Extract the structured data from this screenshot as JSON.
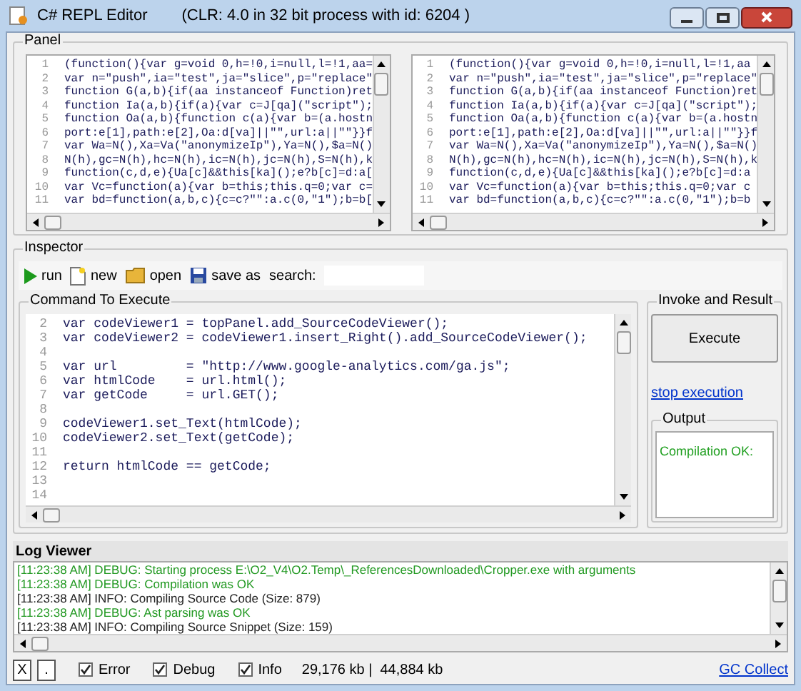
{
  "window": {
    "title": "C# REPL Editor",
    "subtitle": "(CLR: 4.0 in 32 bit process with id: 6204 )"
  },
  "panel": {
    "title": "Panel",
    "viewers": [
      {
        "lines": [
          {
            "number": "1",
            "text": "(function(){var g=void 0,h=!0,i=null,l=!1,aa="
          },
          {
            "number": "2",
            "text": "var n=\"push\",ia=\"test\",ja=\"slice\",p=\"replace\""
          },
          {
            "number": "3",
            "text": "function G(a,b){if(aa instanceof Function)ret"
          },
          {
            "number": "4",
            "text": "function Ia(a,b){if(a){var c=J[qa](\"script\");"
          },
          {
            "number": "5",
            "text": "function Oa(a,b){function c(a){var b=(a.hostn"
          },
          {
            "number": "6",
            "text": "port:e[1],path:e[2],Oa:d[va]||\"\",url:a||\"\"}}f"
          },
          {
            "number": "7",
            "text": "var Wa=N(),Xa=Va(\"anonymizeIp\"),Ya=N(),$a=N()"
          },
          {
            "number": "8",
            "text": "N(h),gc=N(h),hc=N(h),ic=N(h),jc=N(h),S=N(h),k"
          },
          {
            "number": "9",
            "text": "function(c,d,e){Ua[c]&&this[ka]();e?b[c]=d:a["
          },
          {
            "number": "10",
            "text": "var Vc=function(a){var b=this;this.q=0;var c="
          },
          {
            "number": "11",
            "text": "var bd=function(a,b,c){c=c?\"\":a.c(0,\"1\");b=b["
          }
        ]
      },
      {
        "lines": [
          {
            "number": "1",
            "text": "(function(){var g=void 0,h=!0,i=null,l=!1,aa"
          },
          {
            "number": "2",
            "text": "var n=\"push\",ia=\"test\",ja=\"slice\",p=\"replace\""
          },
          {
            "number": "3",
            "text": "function G(a,b){if(aa instanceof Function)ret"
          },
          {
            "number": "4",
            "text": "function Ia(a,b){if(a){var c=J[qa](\"script\");"
          },
          {
            "number": "5",
            "text": "function Oa(a,b){function c(a){var b=(a.hostn"
          },
          {
            "number": "6",
            "text": "port:e[1],path:e[2],Oa:d[va]||\"\",url:a||\"\"}}f"
          },
          {
            "number": "7",
            "text": "var Wa=N(),Xa=Va(\"anonymizeIp\"),Ya=N(),$a=N()"
          },
          {
            "number": "8",
            "text": "N(h),gc=N(h),hc=N(h),ic=N(h),jc=N(h),S=N(h),k"
          },
          {
            "number": "9",
            "text": "function(c,d,e){Ua[c]&&this[ka]();e?b[c]=d:a"
          },
          {
            "number": "10",
            "text": "var Vc=function(a){var b=this;this.q=0;var c"
          },
          {
            "number": "11",
            "text": "var bd=function(a,b,c){c=c?\"\":a.c(0,\"1\");b=b"
          }
        ]
      }
    ]
  },
  "inspector": {
    "title": "Inspector",
    "toolbar": [
      {
        "kind": "run",
        "label": "run"
      },
      {
        "kind": "new",
        "label": "new"
      },
      {
        "kind": "open",
        "label": "open"
      },
      {
        "kind": "save",
        "label": "save as"
      }
    ],
    "search_label": "search:"
  },
  "command": {
    "title": "Command To Execute",
    "lines": [
      {
        "number": "2",
        "text": "var codeViewer1 = topPanel.add_SourceCodeViewer();"
      },
      {
        "number": "3",
        "text": "var codeViewer2 = codeViewer1.insert_Right().add_SourceCodeViewer();"
      },
      {
        "number": "4"
      },
      {
        "number": "5",
        "text": "var url         = \"http://www.google-analytics.com/ga.js\";"
      },
      {
        "number": "6",
        "text": "var htmlCode    = url.html();"
      },
      {
        "number": "7",
        "text": "var getCode     = url.GET();"
      },
      {
        "number": "8"
      },
      {
        "number": "9",
        "text": "codeViewer1.set_Text(htmlCode);"
      },
      {
        "number": "10",
        "text": "codeViewer2.set_Text(getCode);"
      },
      {
        "number": "11"
      },
      {
        "number": "12",
        "text": "return htmlCode == getCode;"
      },
      {
        "number": "13"
      },
      {
        "number": "14"
      }
    ]
  },
  "invoke": {
    "title": "Invoke and Result",
    "execute": "Execute",
    "stop": "stop execution",
    "output_title": "Output",
    "output": "Compilation OK:"
  },
  "log": {
    "title": "Log Viewer",
    "entries": [
      {
        "kind": "debug",
        "text": "[11:23:38 AM] DEBUG: Starting process E:\\O2_V4\\O2.Temp\\_ReferencesDownloaded\\Cropper.exe with arguments"
      },
      {
        "kind": "debug",
        "text": "[11:23:38 AM] DEBUG: Compilation was OK"
      },
      {
        "kind": "info",
        "text": "[11:23:38 AM] INFO: Compiling Source Code (Size: 879)"
      },
      {
        "kind": "debug",
        "text": "[11:23:38 AM] DEBUG: Ast parsing was OK"
      },
      {
        "kind": "info",
        "text": "[11:23:38 AM] INFO: Compiling Source Snippet (Size: 159)"
      }
    ]
  },
  "status_bar": {
    "buttons": [
      "X",
      "."
    ],
    "filters": [
      {
        "label": "Error",
        "checked": true
      },
      {
        "label": "Debug",
        "checked": true
      },
      {
        "label": "Info",
        "checked": true
      }
    ],
    "memory": "29,176 kb |  44,884 kb",
    "gc_link": "GC Collect"
  }
}
